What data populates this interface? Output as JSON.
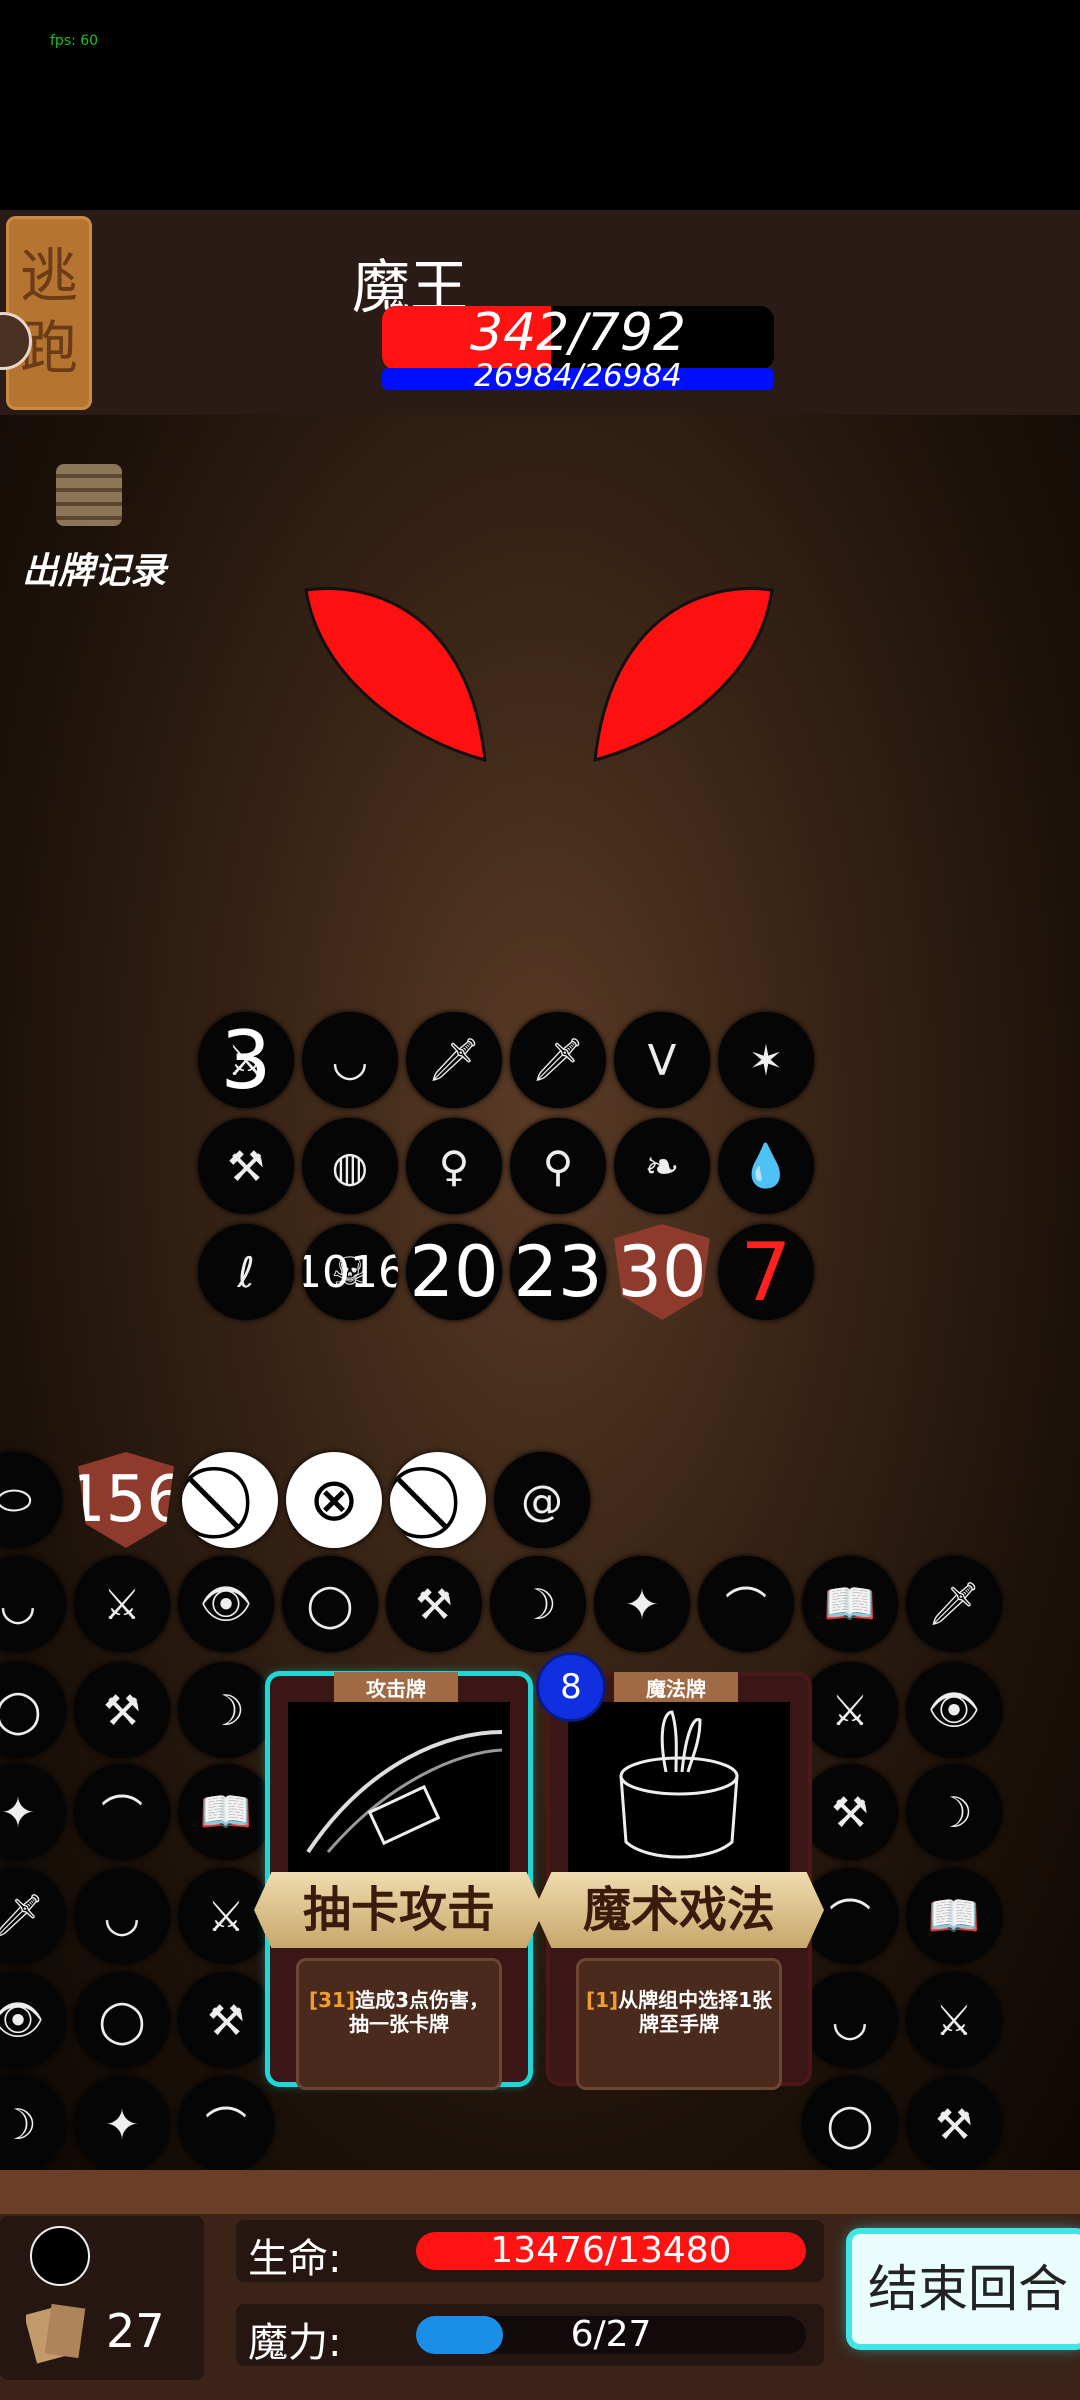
{
  "hud": {
    "fps": "fps: 60"
  },
  "top": {
    "escape_label": "逃跑",
    "boss_name": "魔王",
    "boss_hp": "342/792",
    "boss_hp_fraction": 0.432,
    "boss_mp": "26984/26984"
  },
  "arena": {
    "log_label": "出牌记录",
    "boss_buffs": [
      [
        "3",
        "",
        "",
        "",
        "",
        ""
      ],
      [
        "",
        "",
        "",
        "",
        "",
        ""
      ],
      [
        "",
        "1016",
        "20",
        "23",
        "30",
        "7"
      ]
    ],
    "player_status_values": [
      "156"
    ]
  },
  "hand": [
    {
      "type": "攻击牌",
      "name": "抽卡攻击",
      "desc_code": "[31]",
      "desc": "造成3点伤害，抽一张卡牌",
      "selected": true
    },
    {
      "type": "魔法牌",
      "name": "魔术戏法",
      "desc_code": "[1]",
      "desc": "从牌组中选择1张牌至手牌",
      "cost": "8",
      "selected": false
    }
  ],
  "player": {
    "deck_count": "27",
    "hp_label": "生命:",
    "hp_value": "13476/13480",
    "hp_fraction": 0.9997,
    "mp_label": "魔力:",
    "mp_value": "6/27",
    "mp_fraction": 0.222,
    "end_turn_label": "结束回合"
  },
  "colors": {
    "hp": "#ff1212",
    "mp": "#1b8fe8",
    "accent": "#21d6d6"
  }
}
